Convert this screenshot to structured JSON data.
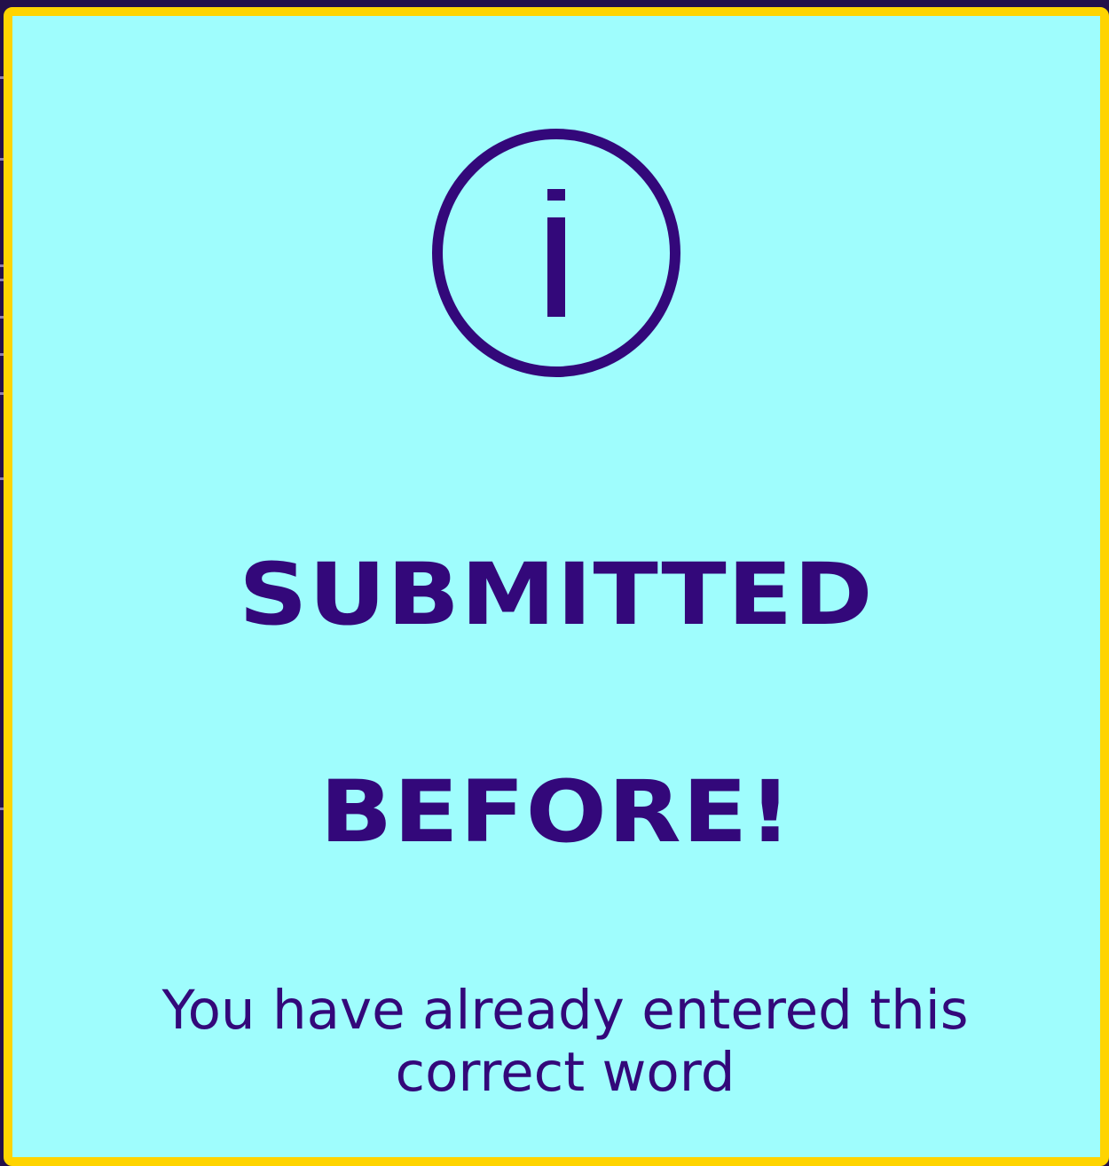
{
  "modal": {
    "icon": "info-icon",
    "title_line_1": "SUBMITTED",
    "title_line_2": "BEFORE!",
    "message": "You have already entered this correct word"
  },
  "colors": {
    "background": "#9ffdfd",
    "border": "#ffd400",
    "text": "#33087a",
    "backdrop": "#24104a"
  }
}
